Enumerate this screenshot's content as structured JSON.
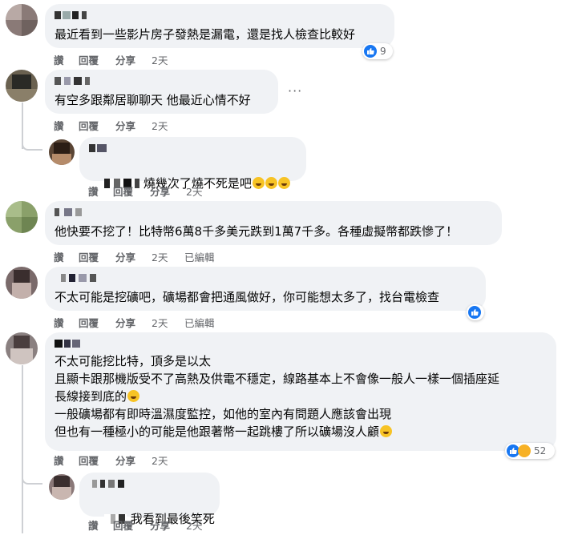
{
  "comments": [
    {
      "text": [
        "最近看到一些影片房子發熱是漏電，還是找人檢查比較好"
      ],
      "actions": {
        "like": "讚",
        "reply": "回覆",
        "share": "分享",
        "time": "2天"
      },
      "reactions": {
        "types": [
          "like-icon"
        ],
        "count": "9"
      }
    },
    {
      "text": [
        "有空多跟鄰居聊聊天 他最近心情不好"
      ],
      "actions": {
        "like": "讚",
        "reply": "回覆",
        "share": "分享",
        "time": "2天"
      },
      "more": "···",
      "replies": [
        {
          "text": [
            "燒幾次了燒不死是吧"
          ],
          "emoji": [
            "rolling-laughing",
            "rolling-laughing",
            "rolling-laughing"
          ],
          "actions": {
            "like": "讚",
            "reply": "回覆",
            "share": "分享",
            "time": "2天"
          }
        }
      ]
    },
    {
      "text": [
        "他快要不挖了！比特幣6萬8千多美元跌到1萬7千多。各種虛擬幣都跌慘了！"
      ],
      "actions": {
        "like": "讚",
        "reply": "回覆",
        "share": "分享",
        "time": "2天",
        "edited": "已編輯"
      }
    },
    {
      "text": [
        "不太可能是挖礦吧，礦場都會把通風做好，你可能想太多了，找台電檢查"
      ],
      "actions": {
        "like": "讚",
        "reply": "回覆",
        "share": "分享",
        "time": "2天",
        "edited": "已編輯"
      },
      "reactions": {
        "types": [
          "like-icon"
        ],
        "count": ""
      }
    },
    {
      "text": [
        "不太可能挖比特，頂多是以太",
        "且顯卡跟那機版受不了高熱及供電不穩定，線路基本上不會像一般人一樣一個插座延",
        "長線接到底的",
        "一般礦場都有即時溫濕度監控，如他的室內有問題人應該會出現",
        "但也有一種極小的可能是他跟著幣一起跳樓了所以礦場沒人顧"
      ],
      "actions": {
        "like": "讚",
        "reply": "回覆",
        "share": "分享",
        "time": "2天"
      },
      "reactions": {
        "types": [
          "like-icon",
          "haha-icon"
        ],
        "count": "52"
      },
      "replies": [
        {
          "text": [
            "我看到最後笑死"
          ],
          "actions": {
            "like": "讚",
            "reply": "回覆",
            "share": "分享",
            "time": "2天"
          }
        }
      ]
    }
  ],
  "colors": {
    "bubble": "#f0f2f5",
    "meta": "#65676b",
    "like": "#1877f2",
    "haha": "#f7b125"
  }
}
